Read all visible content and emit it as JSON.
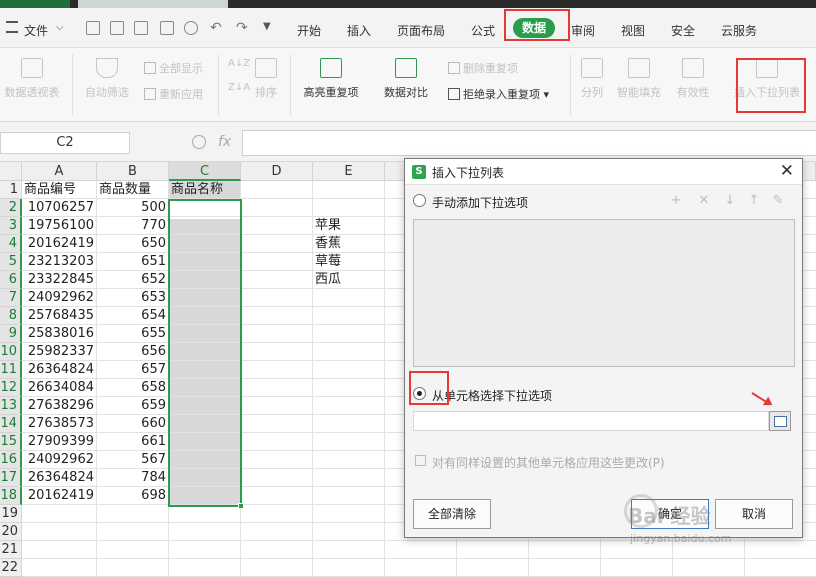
{
  "menu": {
    "file_label": "文件",
    "tabs": [
      "开始",
      "插入",
      "页面布局",
      "公式",
      "数据",
      "审阅",
      "视图",
      "安全",
      "云服务"
    ],
    "active_tab": "数据"
  },
  "ribbon": {
    "pivot": "数据透视表",
    "auto_filter": "自动筛选",
    "show_all": "全部显示",
    "reapply": "重新应用",
    "sort": "排序",
    "highlight_dup": "高亮重复项",
    "data_compare": "数据对比",
    "delete_dup": "删除重复项",
    "reject_dup": "拒绝录入重复项",
    "split": "分列",
    "smart_fill": "智能填充",
    "validity": "有效性",
    "insert_dropdown": "插入下拉列表"
  },
  "formula_bar": {
    "name_box": "C2",
    "fx": "fx",
    "value": ""
  },
  "sheet": {
    "columns": [
      "A",
      "B",
      "C",
      "D",
      "E"
    ],
    "rows": [
      "1",
      "2",
      "3",
      "4",
      "5",
      "6",
      "7",
      "8",
      "9",
      "10",
      "11",
      "12",
      "13",
      "14",
      "15",
      "16",
      "17",
      "18",
      "19",
      "20",
      "21",
      "22"
    ],
    "header_row": [
      "商品编号",
      "商品数量",
      "商品名称"
    ],
    "col_a": [
      "10706257",
      "19756100",
      "20162419",
      "23213203",
      "23322845",
      "24092962",
      "25768435",
      "25838016",
      "25982337",
      "26364824",
      "26634084",
      "27638296",
      "27638573",
      "27909399",
      "24092962",
      "26364824",
      "20162419"
    ],
    "col_b": [
      "500",
      "770",
      "650",
      "651",
      "652",
      "653",
      "654",
      "655",
      "656",
      "657",
      "658",
      "659",
      "660",
      "661",
      "567",
      "784",
      "698"
    ],
    "col_e": [
      "苹果",
      "香蕉",
      "草莓",
      "西瓜"
    ]
  },
  "dialog": {
    "title": "插入下拉列表",
    "logo": "S",
    "option_manual": "手动添加下拉选项",
    "option_cells": "从单元格选择下拉选项",
    "range_value": "",
    "apply_all": "对有同样设置的其他单元格应用这些更改(P)",
    "clear_all": "全部清除",
    "ok": "确定",
    "cancel": "取消"
  },
  "watermark": {
    "line1": "Bai 经验",
    "line2": "jingyan.baidu.com"
  },
  "colors": {
    "accent_green": "#2e9b4c",
    "highlight_red": "#e53935"
  }
}
